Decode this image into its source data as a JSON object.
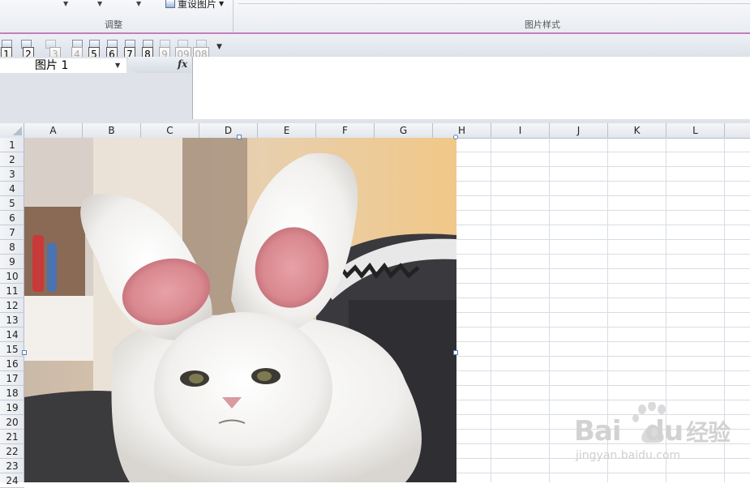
{
  "ribbon": {
    "reset_picture_label": "重设图片",
    "group_adjust_label": "调整",
    "group_picture_styles_label": "图片样式"
  },
  "quick_access": {
    "keytips": [
      "1",
      "2",
      "3",
      "4",
      "5",
      "6",
      "7",
      "8",
      "9",
      "09",
      "08"
    ]
  },
  "formula_bar": {
    "name_box_value": "图片 1",
    "fx_label": "fx",
    "formula_value": ""
  },
  "sheet": {
    "columns": [
      "A",
      "B",
      "C",
      "D",
      "E",
      "F",
      "G",
      "H",
      "I",
      "J",
      "K",
      "L"
    ],
    "rows": [
      "1",
      "2",
      "3",
      "4",
      "5",
      "6",
      "7",
      "8",
      "9",
      "10",
      "11",
      "12",
      "13",
      "14",
      "15",
      "16",
      "17",
      "18",
      "19",
      "20",
      "21",
      "22",
      "23",
      "24"
    ]
  },
  "watermark": {
    "brand": "Bai",
    "brand_suffix": "du",
    "product": "经验",
    "url": "jingyan.baidu.com"
  },
  "colors": {
    "ribbon_accent": "#c47fbc",
    "header_bg": "#e2e6ec",
    "gridline": "#d8dde4"
  }
}
